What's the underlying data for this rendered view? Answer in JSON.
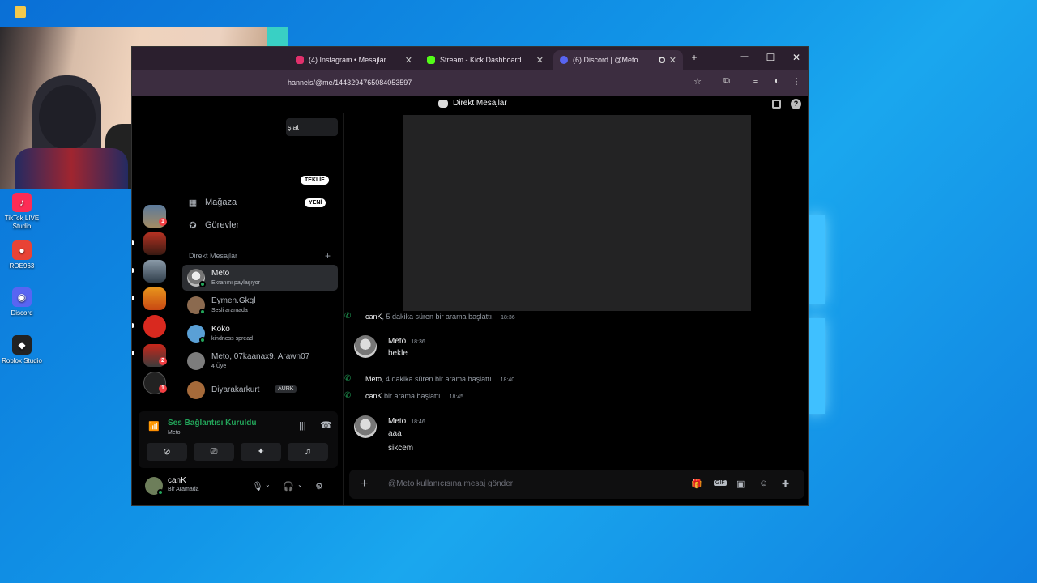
{
  "desktop": {
    "icons": [
      {
        "label": "TikTok LIVE Studio",
        "glyph": "♪",
        "color": "#fe2c55"
      },
      {
        "label": "ROE963",
        "glyph": "●",
        "color": "#e84335"
      },
      {
        "label": "Discord",
        "glyph": "◉",
        "color": "#5865f2"
      },
      {
        "label": "Roblox Studio",
        "glyph": "◆",
        "color": "#222222"
      }
    ]
  },
  "browser": {
    "tabs": [
      {
        "label": "(4) Instagram • Mesajlar",
        "icon": "instagram-icon",
        "color": "#e1306c"
      },
      {
        "label": "Stream - Kick Dashboard",
        "icon": "kick-icon",
        "color": "#53fc18"
      },
      {
        "label": "(6) Discord | @Meto",
        "icon": "discord-icon",
        "color": "#5865f2"
      }
    ],
    "new_tab": "+",
    "minimize": "—",
    "maximize": "☐",
    "close": "✕",
    "url": "hannels/@me/1443294765084053597"
  },
  "discord": {
    "header_title": "Direkt Mesajlar",
    "search_fragment": "şlat",
    "nav": [
      {
        "label": "Mağaza",
        "icon": "shop-icon",
        "glyph": "▦",
        "badge": "YENİ"
      },
      {
        "label": "Görevler",
        "icon": "quests-icon",
        "glyph": "✪",
        "badge": ""
      }
    ],
    "offer_badge": "TEKLİF",
    "dm_header": "Direkt Mesajlar",
    "dm_plus": "+",
    "dms": [
      {
        "name": "Meto",
        "sub": "Ekranını paylaşıyor",
        "color": "#9a9a9a"
      },
      {
        "name": "Eymen.Gkgl",
        "sub": "Sesli aramada",
        "color": "#8b6a4f"
      },
      {
        "name": "Koko",
        "sub": "kindness spread",
        "color": "#5aa0d6"
      },
      {
        "name": "Meto, 07kaanax9, Arawn07",
        "sub": "4 Üye",
        "color": "#7c7c7c"
      },
      {
        "name": "Diyarakarkurt",
        "sub": "",
        "tag": "AURK",
        "color": "#a56a3a"
      }
    ],
    "server_badges": [
      "1",
      "2",
      "1"
    ],
    "voice": {
      "title": "Ses Bağlantısı Kuruldu",
      "sub": "Meto"
    },
    "user": {
      "name": "canK",
      "status": "Bir Aramada"
    },
    "messages": [
      {
        "type": "system",
        "actor": "canK",
        "text": ", 5 dakika süren bir arama başlattı.",
        "time": "18:36"
      },
      {
        "type": "message",
        "author": "Meto",
        "time": "18:36",
        "lines": [
          "bekle"
        ]
      },
      {
        "type": "system",
        "actor": "Meto",
        "text": ", 4 dakika süren bir arama başlattı.",
        "time": "18:40"
      },
      {
        "type": "system",
        "actor": "canK",
        "text": " bir arama başlattı.",
        "time": "18:45"
      },
      {
        "type": "message",
        "author": "Meto",
        "time": "18:46",
        "lines": [
          "aaa",
          "sikcem"
        ]
      }
    ],
    "composer_placeholder": "@Meto kullanıcısına mesaj gönder",
    "composer_plus": "+"
  }
}
